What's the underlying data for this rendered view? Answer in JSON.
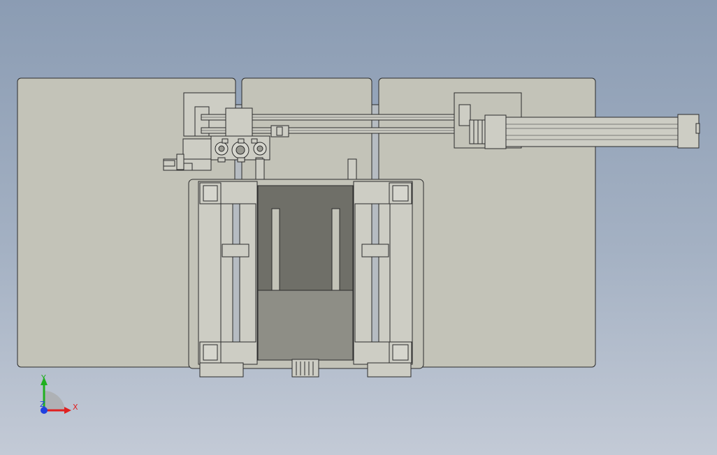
{
  "viewport": {
    "background_top": "#8b9cb3",
    "background_bottom": "#c3cad6"
  },
  "model": {
    "plate_color": "#c3c3b8",
    "part_color": "#cdcdc4",
    "dark_plate_color": "#6f6f68",
    "mid_plate_color": "#8e8e86",
    "outline_color": "#2b2b2b"
  },
  "triad": {
    "x_label": "X",
    "y_label": "Y",
    "z_label": "Z",
    "x_color": "#e02020",
    "y_color": "#20b020",
    "z_color": "#2040e0"
  }
}
